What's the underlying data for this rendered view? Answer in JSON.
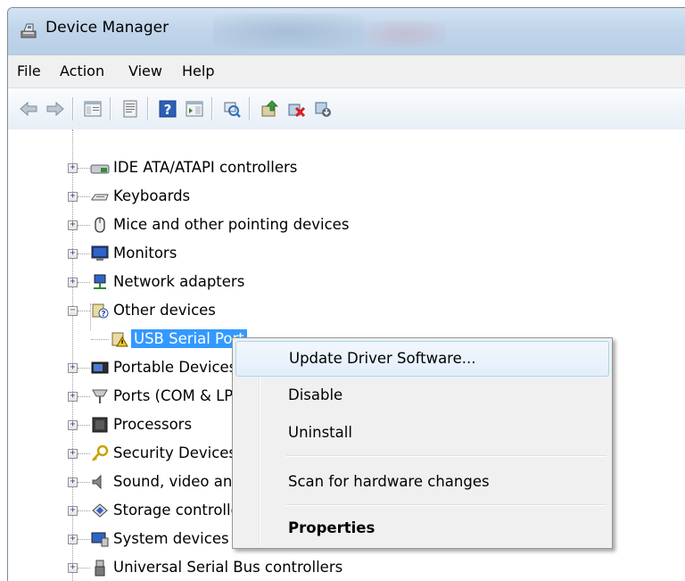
{
  "window": {
    "title": "Device Manager"
  },
  "menubar": {
    "items": [
      "File",
      "Action",
      "View",
      "Help"
    ]
  },
  "toolbar": {
    "icons": [
      "back-arrow-icon",
      "forward-arrow-icon",
      "console-tree-icon",
      "properties-icon",
      "help-icon",
      "action-pane-icon",
      "scan-hardware-icon",
      "update-driver-icon",
      "uninstall-icon",
      "disable-icon"
    ]
  },
  "tree": {
    "nodes": [
      {
        "label": "IDE ATA/ATAPI controllers",
        "icon": "ide-controller-icon",
        "expander": "+"
      },
      {
        "label": "Keyboards",
        "icon": "keyboard-icon",
        "expander": "+"
      },
      {
        "label": "Mice and other pointing devices",
        "icon": "mouse-icon",
        "expander": "+"
      },
      {
        "label": "Monitors",
        "icon": "monitor-icon",
        "expander": "+"
      },
      {
        "label": "Network adapters",
        "icon": "network-adapter-icon",
        "expander": "+"
      },
      {
        "label": "Other devices",
        "icon": "unknown-device-icon",
        "expander": "−"
      },
      {
        "label": "USB Serial Port",
        "icon": "warning-device-icon",
        "selected": true
      },
      {
        "label": "Portable Devices",
        "icon": "portable-device-icon",
        "expander": "+"
      },
      {
        "label": "Ports (COM & LPT)",
        "icon": "port-icon",
        "expander": "+"
      },
      {
        "label": "Processors",
        "icon": "processor-icon",
        "expander": "+"
      },
      {
        "label": "Security Devices",
        "icon": "security-device-icon",
        "expander": "+"
      },
      {
        "label": "Sound, video and game controllers",
        "icon": "sound-icon",
        "expander": "+"
      },
      {
        "label": "Storage controllers",
        "icon": "storage-icon",
        "expander": "+"
      },
      {
        "label": "System devices",
        "icon": "system-device-icon",
        "expander": "+"
      },
      {
        "label": "Universal Serial Bus controllers",
        "icon": "usb-icon",
        "expander": "+"
      }
    ]
  },
  "context_menu": {
    "items": [
      {
        "label": "Update Driver Software...",
        "hover": true
      },
      {
        "label": "Disable"
      },
      {
        "label": "Uninstall"
      },
      {
        "label": "Scan for hardware changes"
      },
      {
        "label": "Properties",
        "bold": true
      }
    ]
  },
  "colors": {
    "selection": "#3399ff",
    "titlebar": "#c1d5ea",
    "menu_hover_border": "#a8d8eb"
  }
}
